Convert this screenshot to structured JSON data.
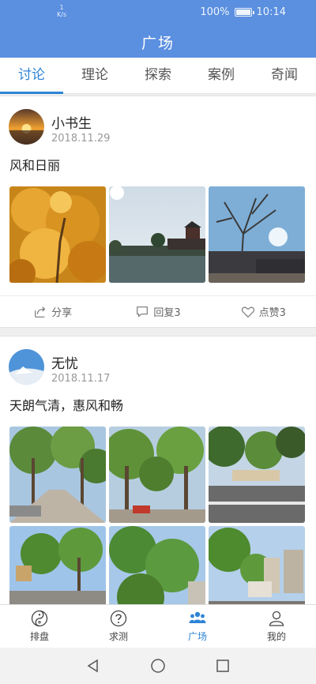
{
  "status_bar": {
    "net_speed": "1",
    "net_unit": "K/s",
    "battery": "100%",
    "time": "10:14"
  },
  "header": {
    "title": "广场"
  },
  "tabs": [
    {
      "label": "讨论",
      "active": true
    },
    {
      "label": "理论",
      "active": false
    },
    {
      "label": "探索",
      "active": false
    },
    {
      "label": "案例",
      "active": false
    },
    {
      "label": "奇闻",
      "active": false
    }
  ],
  "posts": [
    {
      "author": "小书生",
      "date": "2018.11.29",
      "text": "风和日丽",
      "actions": {
        "share": "分享",
        "reply": "回复3",
        "like": "点赞3"
      }
    },
    {
      "author": "无忧",
      "date": "2018.11.17",
      "text": "天朗气清，惠风和畅"
    }
  ],
  "bottom_nav": [
    {
      "label": "排盘",
      "icon": "yin-yang-icon",
      "active": false
    },
    {
      "label": "求测",
      "icon": "question-icon",
      "active": false
    },
    {
      "label": "广场",
      "icon": "group-icon",
      "active": true
    },
    {
      "label": "我的",
      "icon": "user-icon",
      "active": false
    }
  ],
  "system_nav": [
    "back-icon",
    "home-icon",
    "recents-icon"
  ],
  "colors": {
    "primary": "#5b8fe0",
    "accent": "#2e84d6"
  }
}
